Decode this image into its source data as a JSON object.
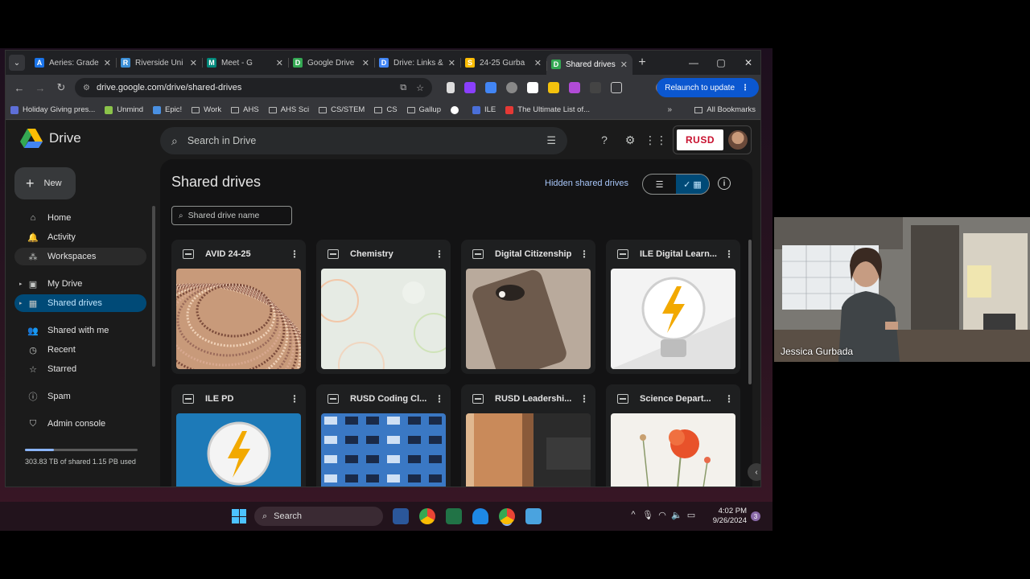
{
  "browser": {
    "tabs": [
      {
        "label": "Aeries: Grade",
        "favicon": "A",
        "color": "#1a73e8",
        "active": false
      },
      {
        "label": "Riverside Uni",
        "favicon": "R",
        "color": "#3c8fd6",
        "active": false
      },
      {
        "label": "Meet - G",
        "favicon": "M",
        "color": "#00897b",
        "active": false
      },
      {
        "label": "Google Drive",
        "favicon": "D",
        "color": "#34a853",
        "active": false
      },
      {
        "label": "Drive: Links &",
        "favicon": "D",
        "color": "#4285f4",
        "active": false
      },
      {
        "label": "24-25 Gurba",
        "favicon": "S",
        "color": "#fbbc04",
        "active": false
      },
      {
        "label": "Shared drives",
        "favicon": "D",
        "color": "#34a853",
        "active": true
      }
    ],
    "url": "drive.google.com/drive/shared-drives",
    "relaunch_label": "Relaunch to update",
    "bookmarks": [
      {
        "label": "Holiday Giving pres...",
        "color": "#5e6fd8"
      },
      {
        "label": "Unmind",
        "color": "#8bc34a"
      },
      {
        "label": "Epic!",
        "color": "#4a90e2"
      },
      {
        "label": "Work",
        "folder": true
      },
      {
        "label": "AHS",
        "folder": true
      },
      {
        "label": "AHS Sci",
        "folder": true
      },
      {
        "label": "CS/STEM",
        "folder": true
      },
      {
        "label": "CS",
        "folder": true
      },
      {
        "label": "Gallup",
        "folder": true
      },
      {
        "label": "",
        "color": "#ffffff"
      },
      {
        "label": "ILE",
        "color": "#4a6fd8"
      },
      {
        "label": "The Ultimate List of...",
        "color": "#e53935"
      }
    ],
    "bookmarks_more": "»",
    "all_bookmarks": "All Bookmarks"
  },
  "drive": {
    "brand": "Drive",
    "search_placeholder": "Search in Drive",
    "logo_text": "RUSD",
    "new_label": "New",
    "nav": [
      {
        "label": "Home",
        "icon": "home-icon",
        "glyph": "⌂"
      },
      {
        "label": "Activity",
        "icon": "bell-icon",
        "glyph": "🔔"
      },
      {
        "label": "Workspaces",
        "icon": "workspaces-icon",
        "glyph": "⁂"
      }
    ],
    "nav2": [
      {
        "label": "My Drive",
        "icon": "my-drive-icon",
        "glyph": "▣"
      },
      {
        "label": "Shared drives",
        "icon": "shared-drives-icon",
        "glyph": "▦"
      }
    ],
    "nav3": [
      {
        "label": "Shared with me",
        "icon": "people-icon",
        "glyph": "👥"
      },
      {
        "label": "Recent",
        "icon": "clock-icon",
        "glyph": "◷"
      },
      {
        "label": "Starred",
        "icon": "star-icon",
        "glyph": "☆"
      }
    ],
    "nav4": [
      {
        "label": "Spam",
        "icon": "spam-icon",
        "glyph": "ⓘ"
      }
    ],
    "admin_label": "Admin console",
    "storage_text": "303.83 TB of shared 1.15 PB used",
    "storage_fraction": 0.26,
    "page_title": "Shared drives",
    "hidden_link": "Hidden shared drives",
    "filter_placeholder": "Shared drive name",
    "drives": [
      {
        "name": "AVID 24-25",
        "thumb": "weave"
      },
      {
        "name": "Chemistry",
        "thumb": "bubbles"
      },
      {
        "name": "Digital Citizenship",
        "thumb": "phone"
      },
      {
        "name": "ILE Digital Learn...",
        "thumb": "bulb-light"
      },
      {
        "name": "ILE PD",
        "thumb": "bulb-blue"
      },
      {
        "name": "RUSD Coding Cl...",
        "thumb": "circuit"
      },
      {
        "name": "RUSD Leadershi...",
        "thumb": "wood"
      },
      {
        "name": "Science Depart...",
        "thumb": "flower"
      }
    ]
  },
  "taskbar": {
    "search_label": "Search",
    "time": "4:02 PM",
    "date": "9/26/2024",
    "notifications": "3"
  },
  "video": {
    "participant": "Jessica Gurbada"
  }
}
